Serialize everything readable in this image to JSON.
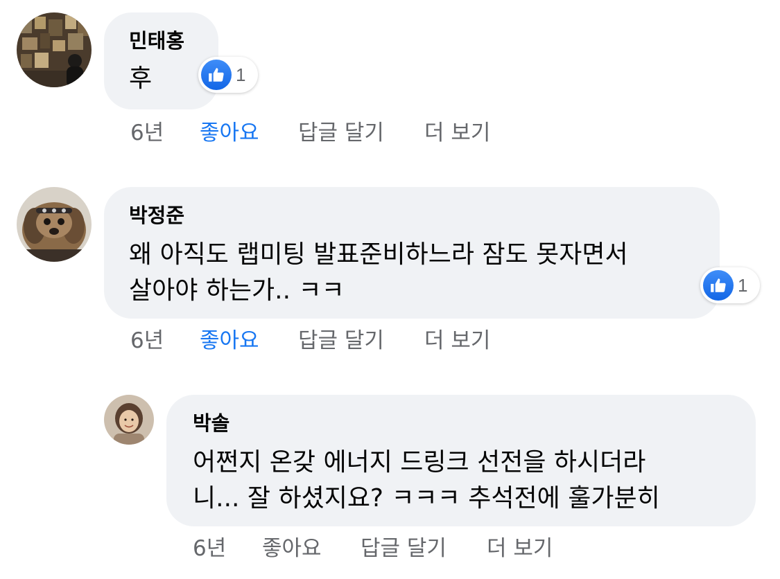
{
  "comments": [
    {
      "author": "민태홍",
      "text_lines": [
        "후"
      ],
      "reaction_count": "1",
      "reaction_icon": "thumbs-up-icon",
      "time": "6년",
      "like_label": "좋아요",
      "reply_label": "답글 달기",
      "more_label": "더 보기",
      "liked_by_viewer": true
    },
    {
      "author": "박정준",
      "text_lines": [
        "왜 아직도 랩미팅 발표준비하느라 잠도 못자면서",
        "살아야 하는가.. ㅋㅋ"
      ],
      "reaction_count": "1",
      "reaction_icon": "thumbs-up-icon",
      "time": "6년",
      "like_label": "좋아요",
      "reply_label": "답글 달기",
      "more_label": "더 보기",
      "liked_by_viewer": true
    },
    {
      "author": "박솔",
      "text_lines": [
        "어쩐지 온갖 에너지 드링크 선전을 하시더라",
        "니... 잘 하셨지요? ㅋㅋㅋ 추석전에 훌가분히"
      ],
      "time": "6년",
      "like_label": "좋아요",
      "reply_label": "답글 달기",
      "more_label": "더 보기",
      "liked_by_viewer": false
    }
  ],
  "colors": {
    "bubble_bg": "#f0f2f5",
    "action_text": "#65676b",
    "liked_text": "#1877f2",
    "like_badge": "#1877f2"
  }
}
